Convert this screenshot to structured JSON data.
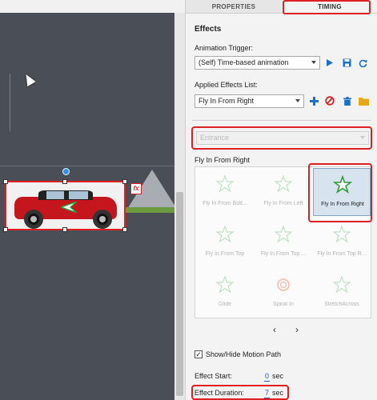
{
  "panel": {
    "tabs": [
      {
        "label": "PROPERTIES"
      },
      {
        "label": "TIMING"
      }
    ],
    "heading": "Effects",
    "animation_trigger_label": "Animation Trigger:",
    "animation_trigger_value": "(Self) Time-based animation",
    "applied_effects_label": "Applied Effects List:",
    "applied_effects_value": "Fly In From Right",
    "category_value": "Entrance",
    "effect_group_label": "Fly In From Right",
    "effects": [
      {
        "label": "Fly In From Bott..."
      },
      {
        "label": "Fly In From Left"
      },
      {
        "label": "Fly In From Right"
      },
      {
        "label": "Fly In From Top"
      },
      {
        "label": "Fly In From Top ..."
      },
      {
        "label": "Fly In From Top R..."
      },
      {
        "label": "Glide"
      },
      {
        "label": "Spiral In"
      },
      {
        "label": "StretchAcross"
      }
    ],
    "show_hide_motion_path": "Show/Hide Motion Path",
    "effect_start_label": "Effect Start:",
    "effect_start_value": "0",
    "effect_duration_label": "Effect Duration:",
    "effect_duration_value": "7",
    "unit": "sec",
    "prev": "‹",
    "next": "›"
  },
  "stage": {
    "fx_badge": "fx"
  },
  "colors": {
    "highlight": "#e02020",
    "accent": "#1a5fb4",
    "stage_bg": "#595e66"
  }
}
